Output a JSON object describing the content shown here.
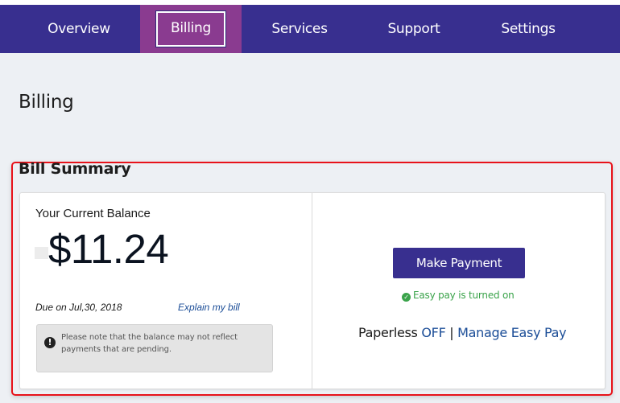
{
  "nav": {
    "items": [
      {
        "label": "Overview",
        "active": false
      },
      {
        "label": "Billing",
        "active": true
      },
      {
        "label": "Services",
        "active": false
      },
      {
        "label": "Support",
        "active": false
      },
      {
        "label": "Settings",
        "active": false
      }
    ]
  },
  "page": {
    "title": "Billing"
  },
  "bill_summary": {
    "title": "Bill Summary",
    "balance_label": "Your Current Balance",
    "balance_amount": "$11.24",
    "due_text": "Due on Jul,30, 2018",
    "explain_link": "Explain my bill",
    "notice_icon": "exclamation-circle-icon",
    "notice_text": "Please note that the balance may not reflect payments that are pending.",
    "make_payment_label": "Make Payment",
    "easy_pay_icon": "check-circle-icon",
    "easy_pay_status": "Easy pay is turned on",
    "paperless_label": "Paperless",
    "paperless_status": "OFF",
    "separator": "|",
    "manage_easy_pay_link": "Manage Easy Pay"
  },
  "colors": {
    "nav_bg": "#382f8f",
    "nav_active_bg": "#8a3b90",
    "highlight_border": "#e8121a",
    "link": "#1b4d97",
    "success": "#3aa34a",
    "page_bg": "#edf0f4"
  }
}
